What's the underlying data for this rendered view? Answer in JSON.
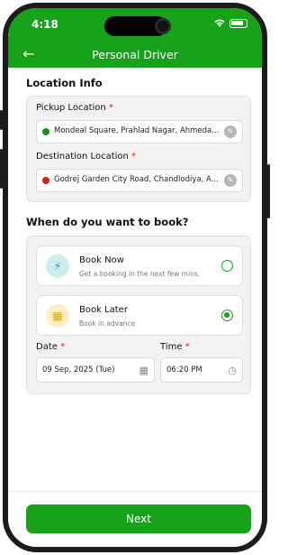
{
  "status_bar": {
    "time": "4:18"
  },
  "header": {
    "title": "Personal Driver",
    "back_icon": "arrow-left-icon"
  },
  "location_info": {
    "section_title": "Location Info",
    "pickup": {
      "label": "Pickup Location",
      "required": "*",
      "value": "Mondeal Square, Prahlad Nagar, Ahmeda...",
      "dot_color": "#1b8f1b"
    },
    "destination": {
      "label": "Destination Location",
      "required": "*",
      "value": "Godrej Garden City Road, Chandlodiya, A...",
      "dot_color": "#e01d1d"
    }
  },
  "booking": {
    "section_title": "When do you want to book?",
    "book_now": {
      "title": "Book Now",
      "subtitle": "Get a booking in the next few mins.",
      "selected": false
    },
    "book_later": {
      "title": "Book Later",
      "subtitle": "Book in advance",
      "selected": true
    },
    "date": {
      "label": "Date",
      "required": "*",
      "value": "09 Sep, 2025 (Tue)"
    },
    "time": {
      "label": "Time",
      "required": "*",
      "value": "06:20 PM"
    }
  },
  "footer": {
    "next_label": "Next"
  },
  "colors": {
    "primary": "#16a31a",
    "required": "#e02020"
  }
}
